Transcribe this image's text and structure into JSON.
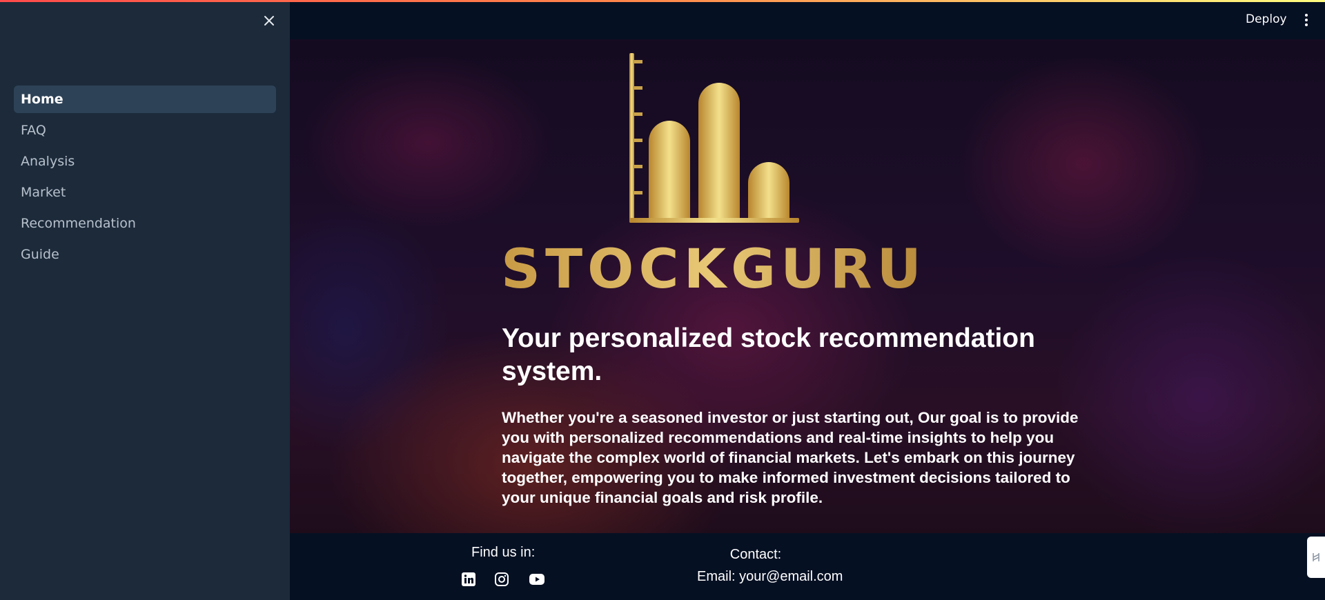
{
  "sidebar": {
    "close_icon": "close-icon",
    "items": [
      {
        "label": "Home",
        "active": true
      },
      {
        "label": "FAQ",
        "active": false
      },
      {
        "label": "Analysis",
        "active": false
      },
      {
        "label": "Market",
        "active": false
      },
      {
        "label": "Recommendation",
        "active": false
      },
      {
        "label": "Guide",
        "active": false
      }
    ]
  },
  "header": {
    "deploy_label": "Deploy",
    "menu_icon": "more-vertical-icon"
  },
  "hero": {
    "logo_text": "STOCKGURU",
    "headline": "Your personalized stock recommendation system.",
    "description": "Whether you're a seasoned investor or just starting out, Our goal is to provide you with personalized recommendations and real-time insights to help you navigate the complex world of financial markets. Let's embark on this journey together, empowering you to make informed investment decisions tailored to your unique financial goals and risk profile."
  },
  "footer": {
    "find_us_label": "Find us in:",
    "socials": [
      "linkedin-icon",
      "instagram-icon",
      "youtube-icon"
    ],
    "contact_label": "Contact:",
    "contact_email": "Email: your@email.com"
  },
  "colors": {
    "sidebar_bg": "#1c2a3a",
    "active_item_bg": "#2e4257",
    "header_bg": "#061023",
    "gold": "#c9a24a"
  }
}
